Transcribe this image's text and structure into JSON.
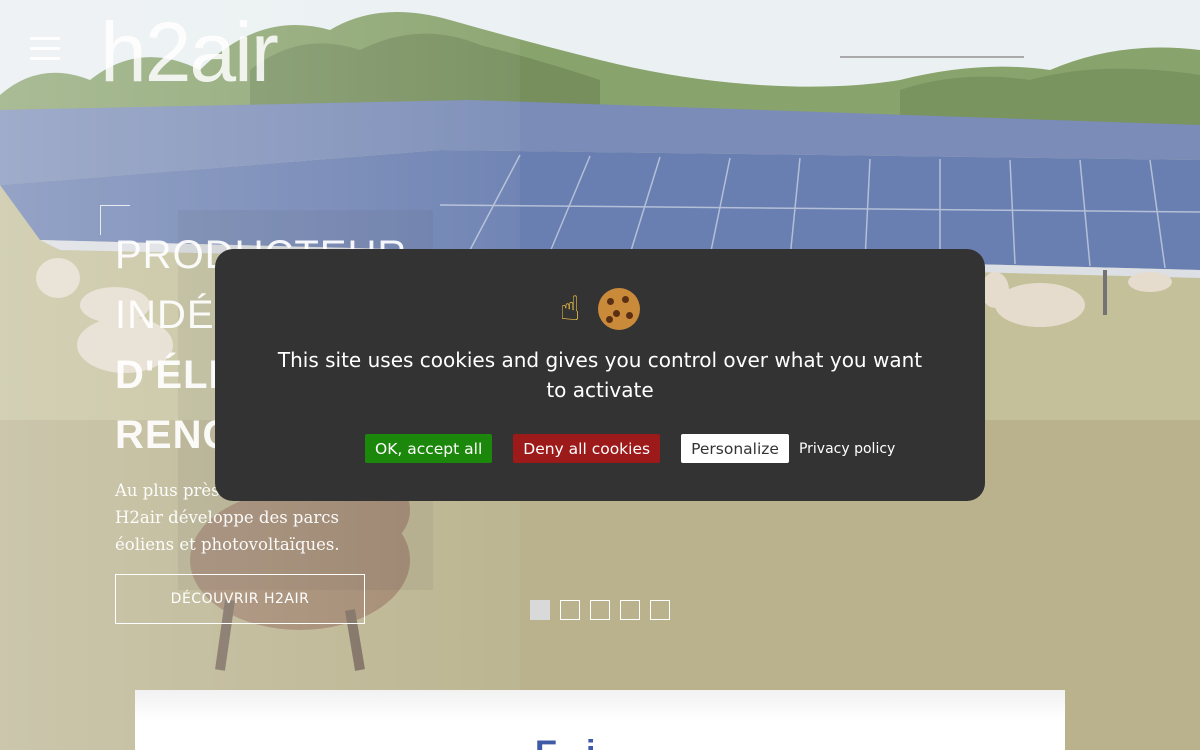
{
  "header": {
    "logo_text": "h2air"
  },
  "hero": {
    "title_line1": "Producteur",
    "title_line2": "indé",
    "title_line3": "d'éle",
    "title_line4": "renc",
    "subtitle_line1": "Au plus près",
    "subtitle_line2": "H2air développe des parcs",
    "subtitle_line3": "éoliens et photovoltaïques.",
    "cta_label": "DÉCOUVRIR H2AIR"
  },
  "slider": {
    "slide_count": 5,
    "active_index": 0
  },
  "cookie_banner": {
    "icons": [
      "pointing-up-finger-icon",
      "cookie-icon"
    ],
    "message": "This site uses cookies and gives you control over what you want to activate",
    "accept_label": "OK, accept all",
    "deny_label": "Deny all cookies",
    "personalize_label": "Personalize",
    "privacy_label": "Privacy policy",
    "colors": {
      "background": "#333333",
      "accept": "#1b870b",
      "deny": "#9c1a1a",
      "personalize": "#ffffff"
    }
  },
  "bottom_card": {
    "heading_partial": "E...i"
  }
}
